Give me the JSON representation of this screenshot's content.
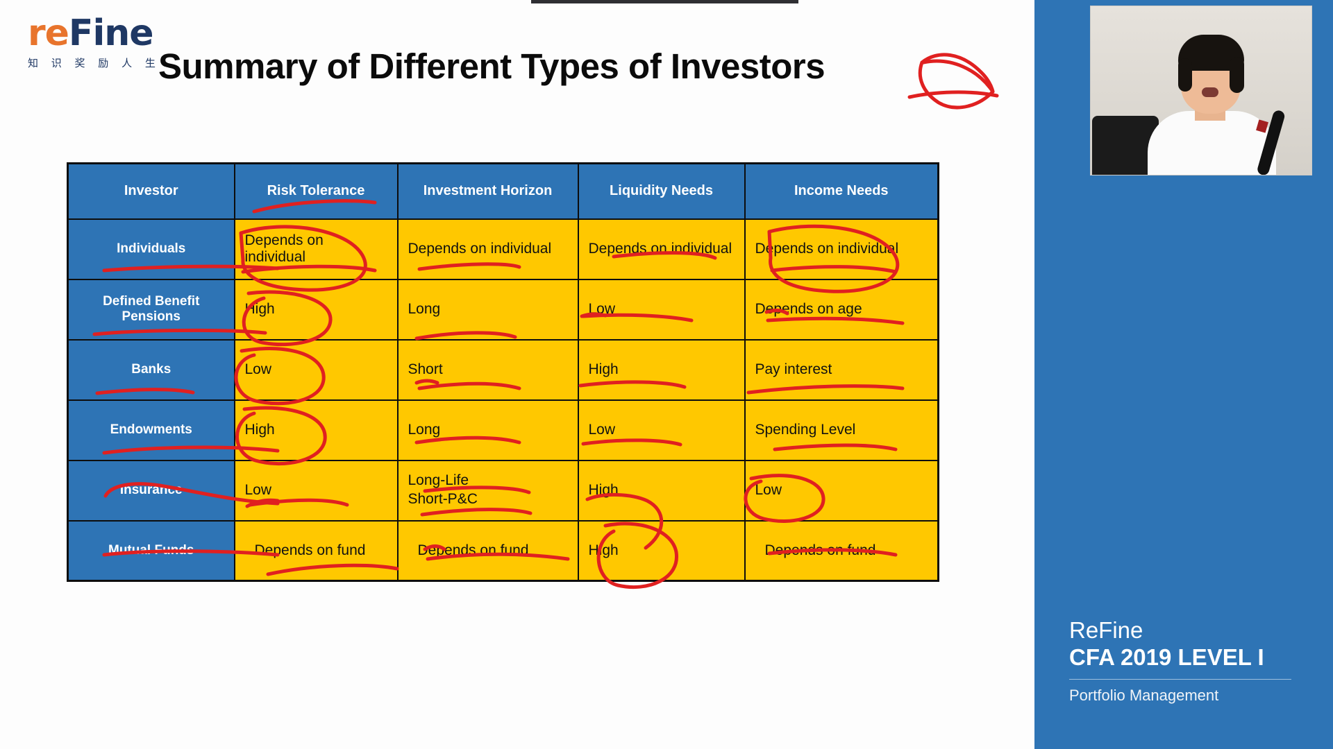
{
  "slide": {
    "title": "Summary of Different Types of Investors",
    "logo": {
      "word_part1": "re",
      "word_part2": "F",
      "word_part3": "ine",
      "tagline": "知 识 奖 励 人 生"
    },
    "annotation_star": "red-star-scribble"
  },
  "table": {
    "headers": [
      "Investor",
      "Risk Tolerance",
      "Investment Horizon",
      "Liquidity Needs",
      "Income Needs"
    ],
    "rows": [
      {
        "investor": "Individuals",
        "risk_tolerance": "Depends on individual",
        "investment_horizon": "Depends on individual",
        "liquidity_needs": "Depends on individual",
        "income_needs": "Depends on individual"
      },
      {
        "investor": "Defined Benefit Pensions",
        "risk_tolerance": "High",
        "investment_horizon": "Long",
        "liquidity_needs": "Low",
        "income_needs": "Depends on age"
      },
      {
        "investor": "Banks",
        "risk_tolerance": "Low",
        "investment_horizon": "Short",
        "liquidity_needs": "High",
        "income_needs": "Pay interest"
      },
      {
        "investor": "Endowments",
        "risk_tolerance": "High",
        "investment_horizon": "Long",
        "liquidity_needs": "Low",
        "income_needs": "Spending Level"
      },
      {
        "investor": "Insurance",
        "risk_tolerance": "Low",
        "investment_horizon": "Long-Life\nShort-P&C",
        "liquidity_needs": "High",
        "income_needs": "Low"
      },
      {
        "investor": "Mutual Funds",
        "risk_tolerance": "Depends on fund",
        "investment_horizon": "Depends on fund",
        "liquidity_needs": "High",
        "income_needs": "Depends on fund"
      }
    ]
  },
  "sidebar": {
    "brand_name": "ReFine",
    "course_title": "CFA 2019 LEVEL I",
    "topic": "Portfolio Management",
    "video_label": "presenter-webcam"
  },
  "colors": {
    "header_blue": "#2E74B5",
    "cell_yellow": "#FFC800",
    "ink_red": "#E02020",
    "border_black": "#0d0d0d",
    "logo_navy": "#1F3864",
    "logo_orange": "#E8742C"
  }
}
